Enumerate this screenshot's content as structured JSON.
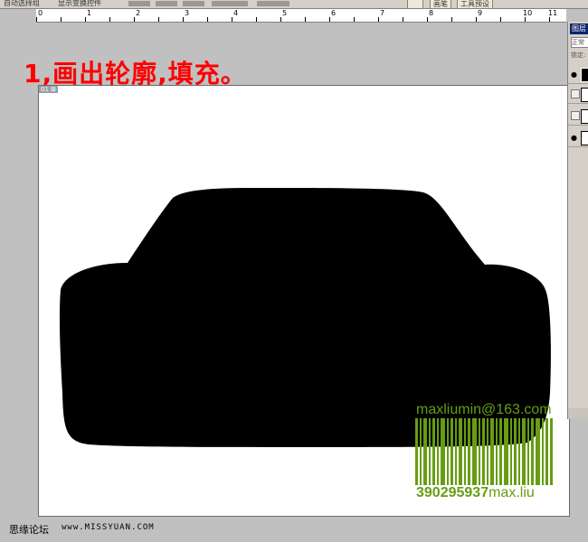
{
  "toolbar": {
    "auto_select": "自动选择组",
    "show_transform": "显示变换控件",
    "tab_brushes": "画笔",
    "tab_tool_presets": "工具预设"
  },
  "ruler": {
    "marks": [
      "0",
      "1",
      "2",
      "3",
      "4",
      "5",
      "6",
      "7",
      "8",
      "9",
      "10",
      "11"
    ]
  },
  "step_title": "1,画出轮廓,填充。",
  "document": {
    "tab_label": "01 ⊠"
  },
  "watermark": {
    "email": "maxliumin@163.com",
    "code": "390295937",
    "name": "max.liu",
    "color": "#669d12"
  },
  "layers_panel": {
    "title": "图层",
    "blend_mode": "正常",
    "lock_label": "锁定:"
  },
  "footer": {
    "site_name": "思缘论坛",
    "site_url": "www.MISSYUAN.COM"
  },
  "colors": {
    "accent_red": "#ff0000",
    "silhouette": "#000000",
    "canvas": "#ffffff",
    "workspace": "#c0c0c0"
  }
}
